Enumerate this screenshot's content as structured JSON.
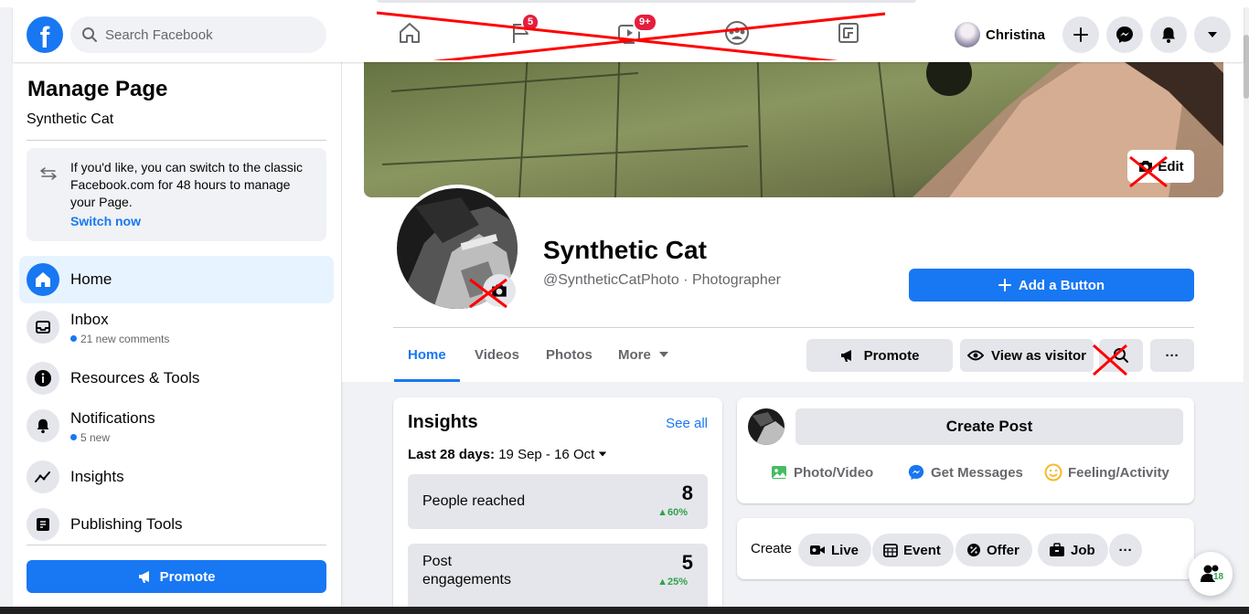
{
  "topbar": {
    "search_placeholder": "Search Facebook",
    "badges": {
      "pages": "5",
      "watch": "9+"
    },
    "user_name": "Christina"
  },
  "sidebar": {
    "title": "Manage Page",
    "page_name": "Synthetic Cat",
    "switch_text": "If you'd like, you can switch to the classic Facebook.com for 48 hours to manage your Page.",
    "switch_link": "Switch now",
    "items": [
      {
        "label": "Home",
        "sub": ""
      },
      {
        "label": "Inbox",
        "sub": "21 new comments"
      },
      {
        "label": "Resources & Tools",
        "sub": ""
      },
      {
        "label": "Notifications",
        "sub": "5 new"
      },
      {
        "label": "Insights",
        "sub": ""
      },
      {
        "label": "Publishing Tools",
        "sub": ""
      }
    ],
    "promote_label": "Promote"
  },
  "profile": {
    "name": "Synthetic Cat",
    "handle": "@SyntheticCatPhoto · Photographer",
    "edit_label": "Edit",
    "add_button_label": "Add a Button"
  },
  "tabs": [
    "Home",
    "Videos",
    "Photos",
    "More"
  ],
  "actions": {
    "promote": "Promote",
    "view_as_visitor": "View as visitor",
    "more": "···"
  },
  "insights": {
    "title": "Insights",
    "see_all": "See all",
    "range_label": "Last 28 days:",
    "range_value": "19 Sep - 16 Oct",
    "stats": [
      {
        "label": "People reached",
        "value": "8",
        "change": "60%"
      },
      {
        "label": "Post engagements",
        "value": "5",
        "change": "25%"
      }
    ]
  },
  "composer": {
    "create_post": "Create Post",
    "actions": [
      "Photo/Video",
      "Get Messages",
      "Feeling/Activity"
    ]
  },
  "create_row": {
    "label": "Create",
    "items": [
      "Live",
      "Event",
      "Offer",
      "Job"
    ],
    "more": "···"
  },
  "fab_count": "18",
  "colors": {
    "accent": "#1877f2",
    "badge": "#e41e3f",
    "positive": "#31a24c",
    "annotation_red": "#ff0000"
  }
}
